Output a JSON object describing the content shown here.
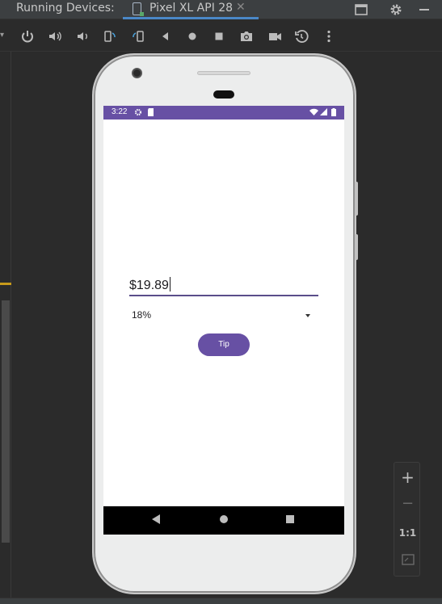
{
  "ide": {
    "panel_title": "Running Devices:",
    "tab_label": "Pixel XL API 28",
    "tab_close": "✕"
  },
  "device_toolbar": {
    "icons": [
      "power-icon",
      "volume-up-icon",
      "volume-down-icon",
      "rotate-left-icon",
      "rotate-right-icon",
      "back-icon",
      "home-icon",
      "overview-icon",
      "screenshot-icon",
      "screen-record-icon",
      "snapshot-icon",
      "more-icon"
    ]
  },
  "phone": {
    "status_bar": {
      "time": "3:22",
      "color": "#6750a4"
    },
    "app": {
      "bill_amount": "$19.89",
      "tip_percent": "18%",
      "tip_button_label": "Tip",
      "accent": "#6750a4"
    }
  },
  "zoom_controls": {
    "zoom_in": "+",
    "zoom_out": "−",
    "actual_size": "1:1"
  }
}
